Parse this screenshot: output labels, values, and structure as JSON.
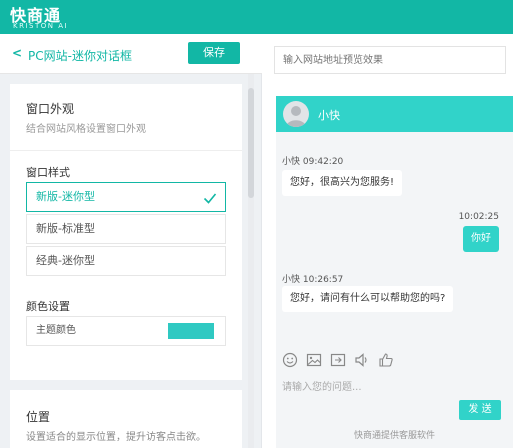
{
  "brand": {
    "name_cn": "快商通",
    "name_en": "KRISTON AI"
  },
  "header": {
    "back_label": "<",
    "title": "PC网站-迷你对话框",
    "save_label": "保存"
  },
  "appearance": {
    "title": "窗口外观",
    "subtitle": "结合网站风格设置窗口外观",
    "style_label": "窗口样式",
    "options": [
      "新版-迷你型",
      "新版-标准型",
      "经典-迷你型"
    ],
    "selected_option": "新版-迷你型",
    "color_section_label": "颜色设置",
    "theme_color_label": "主题颜色",
    "theme_color": "#2fc9c2"
  },
  "position": {
    "title": "位置",
    "subtitle": "设置适合的显示位置，提升访客点击欲。"
  },
  "preview": {
    "url_placeholder": "输入网站地址预览效果"
  },
  "chat": {
    "agent_name": "小快",
    "messages": [
      {
        "side": "left",
        "meta": "小快 09:42:20",
        "text": "您好，很高兴为您服务!"
      },
      {
        "side": "right",
        "meta": "10:02:25",
        "text": "你好"
      },
      {
        "side": "left",
        "meta": "小快 10:26:57",
        "text": "您好，请问有什么可以帮助您的吗?"
      }
    ],
    "tools": [
      "emoji-icon",
      "image-icon",
      "file-icon",
      "voice-icon",
      "thumbs-up-icon"
    ],
    "input_placeholder": "请输入您的问题...",
    "send_label": "发 送",
    "footer": "快商通提供客服软件"
  },
  "colors": {
    "accent": "#12b7a5",
    "chat_accent": "#31d3c9"
  }
}
